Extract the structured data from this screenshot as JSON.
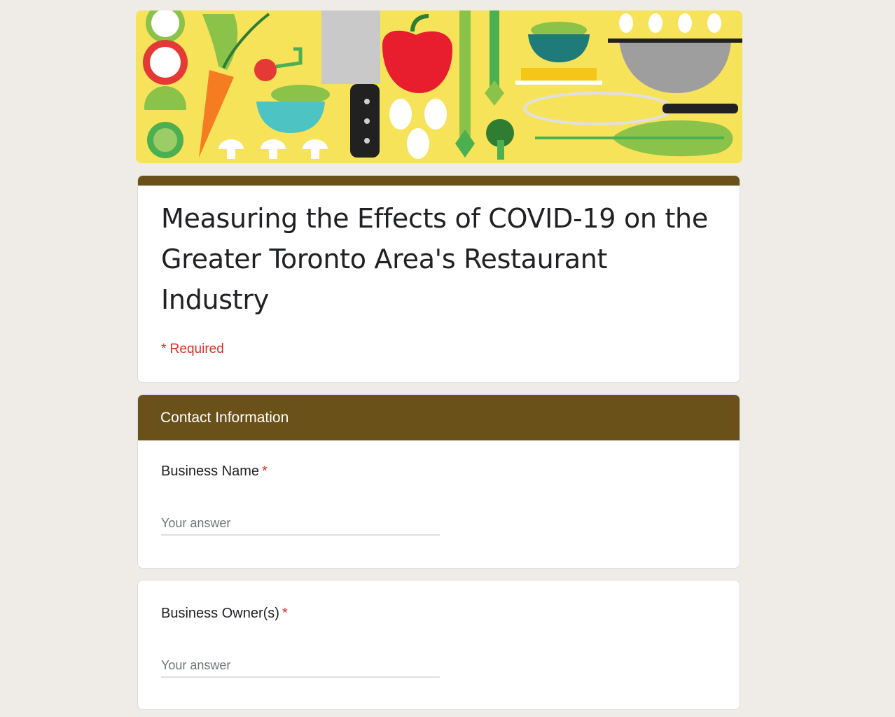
{
  "form": {
    "title": "Measuring the Effects of COVID-19 on the Greater Toronto Area's Restaurant Industry",
    "required_note": "* Required"
  },
  "section": {
    "title": "Contact Information"
  },
  "questions": [
    {
      "label": "Business Name",
      "required_marker": "*",
      "placeholder": "Your answer"
    },
    {
      "label": "Business Owner(s)",
      "required_marker": "*",
      "placeholder": "Your answer"
    }
  ],
  "colors": {
    "accent": "#6a5119",
    "background": "#efebe6",
    "required": "#d93025",
    "header_image_bg": "#f7e35a"
  }
}
